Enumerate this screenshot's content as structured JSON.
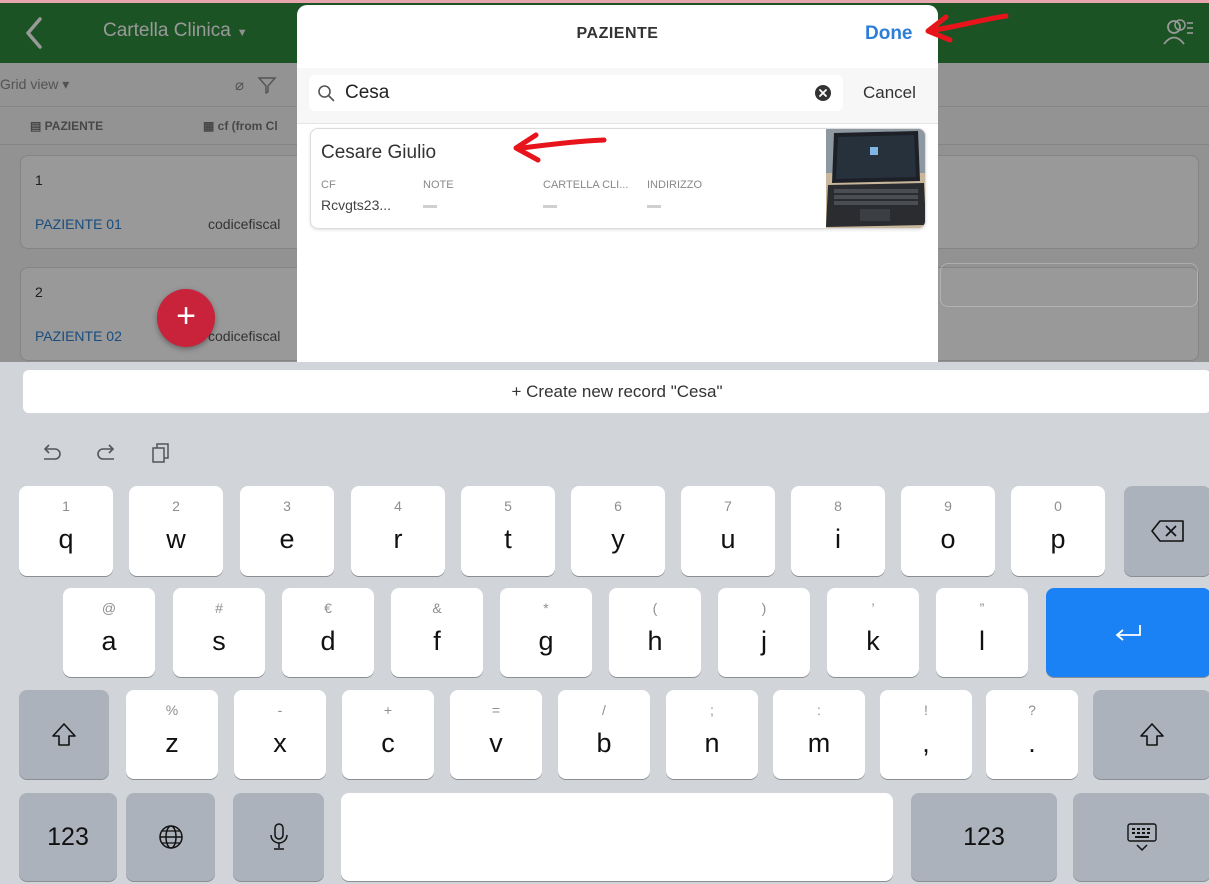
{
  "app": {
    "title": "Cartella Clinica",
    "view": "Grid view",
    "columns": [
      "PAZIENTE",
      "cf (from Cl"
    ],
    "records": [
      {
        "number": "1",
        "name": "PAZIENTE 01",
        "cf": "codicefiscal"
      },
      {
        "number": "2",
        "name": "PAZIENTE 02",
        "cf": "codicefiscal"
      }
    ],
    "accent_color": "#2f8a3d",
    "fab_color": "#c9223b"
  },
  "modal": {
    "title": "PAZIENTE",
    "done_label": "Done",
    "search": {
      "value": "Cesa",
      "cancel_label": "Cancel"
    },
    "result": {
      "name": "Cesare Giulio",
      "fields": [
        {
          "label": "CF",
          "value": "Rcvgts23..."
        },
        {
          "label": "NOTE",
          "value": ""
        },
        {
          "label": "CARTELLA CLI...",
          "value": ""
        },
        {
          "label": "INDIRIZZO",
          "value": ""
        }
      ]
    },
    "link_color": "#2c7ed8"
  },
  "keyboard": {
    "create_label": "+ Create new record \"Cesa\"",
    "row1": [
      {
        "alt": "1",
        "main": "q"
      },
      {
        "alt": "2",
        "main": "w"
      },
      {
        "alt": "3",
        "main": "e"
      },
      {
        "alt": "4",
        "main": "r"
      },
      {
        "alt": "5",
        "main": "t"
      },
      {
        "alt": "6",
        "main": "y"
      },
      {
        "alt": "7",
        "main": "u"
      },
      {
        "alt": "8",
        "main": "i"
      },
      {
        "alt": "9",
        "main": "o"
      },
      {
        "alt": "0",
        "main": "p"
      }
    ],
    "row2": [
      {
        "alt": "@",
        "main": "a"
      },
      {
        "alt": "#",
        "main": "s"
      },
      {
        "alt": "€",
        "main": "d"
      },
      {
        "alt": "&",
        "main": "f"
      },
      {
        "alt": "*",
        "main": "g"
      },
      {
        "alt": "(",
        "main": "h"
      },
      {
        "alt": ")",
        "main": "j"
      },
      {
        "alt": "’",
        "main": "k"
      },
      {
        "alt": "”",
        "main": "l"
      }
    ],
    "row3": [
      {
        "alt": "%",
        "main": "z"
      },
      {
        "alt": "-",
        "main": "x"
      },
      {
        "alt": "+",
        "main": "c"
      },
      {
        "alt": "=",
        "main": "v"
      },
      {
        "alt": "/",
        "main": "b"
      },
      {
        "alt": ";",
        "main": "n"
      },
      {
        "alt": ":",
        "main": "m"
      },
      {
        "alt": "!",
        "main": ","
      },
      {
        "alt": "?",
        "main": "."
      }
    ],
    "numbers_label": "123",
    "return_color": "#1b82f5",
    "icons": [
      "undo-icon",
      "redo-icon",
      "paste-icon",
      "backspace-icon",
      "return-icon",
      "shift-icon",
      "globe-icon",
      "microphone-icon",
      "dismiss-keyboard-icon"
    ]
  },
  "annotation_color": "#e8141c"
}
